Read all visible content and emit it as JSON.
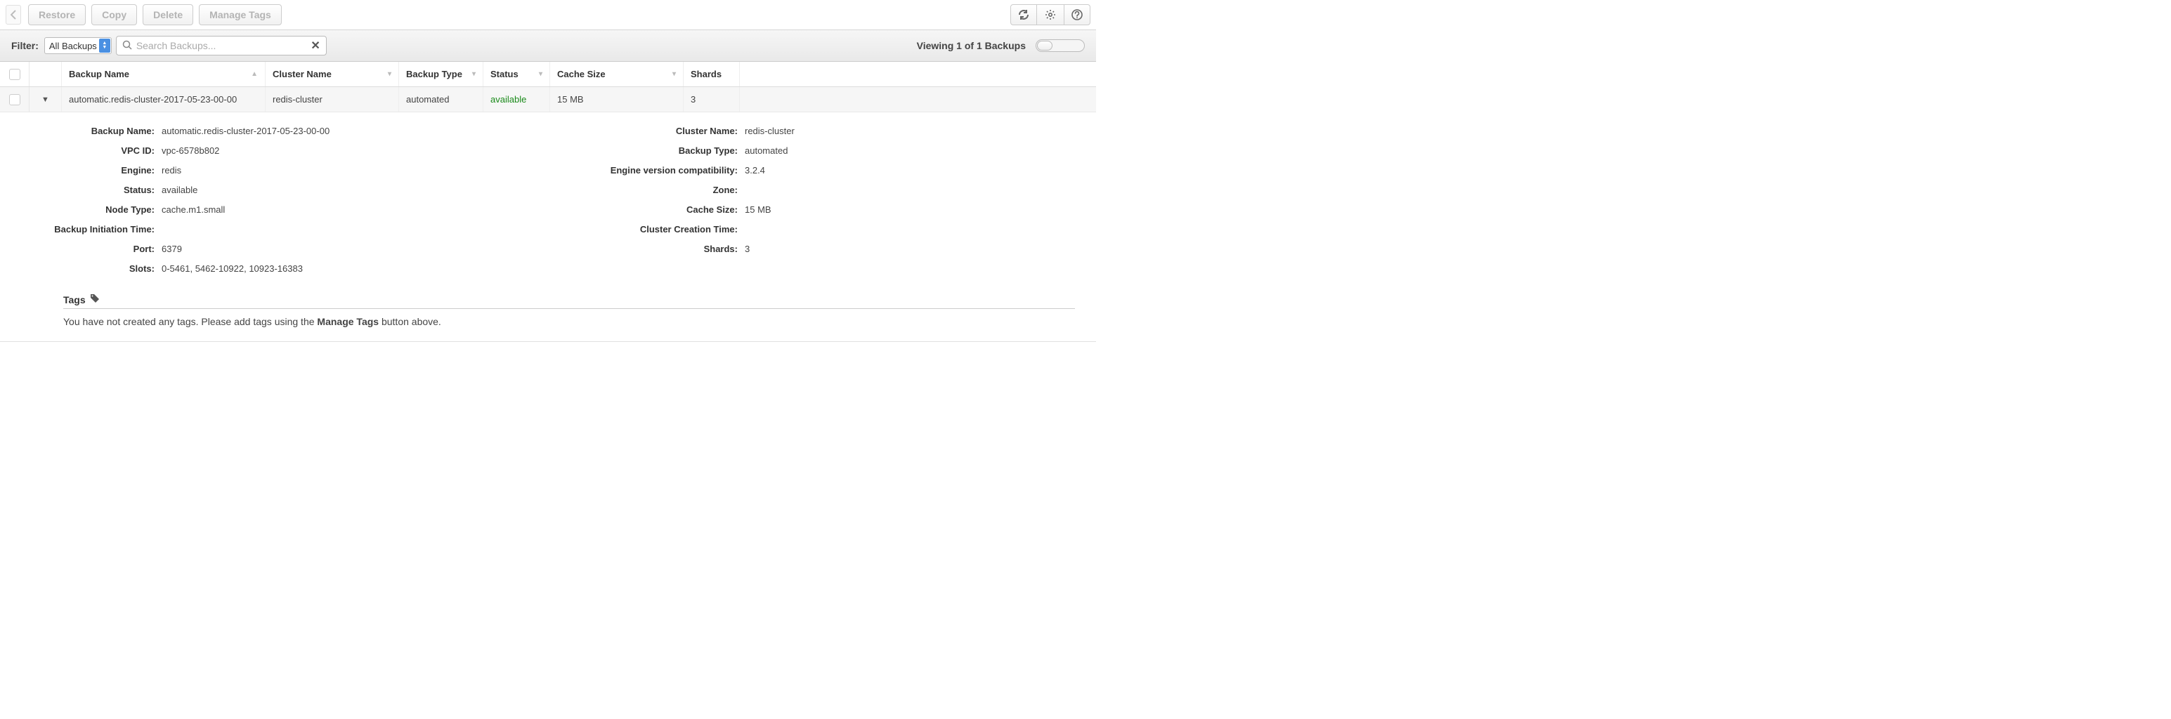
{
  "toolbar": {
    "restore": "Restore",
    "copy": "Copy",
    "delete": "Delete",
    "manage_tags": "Manage Tags"
  },
  "filter": {
    "label": "Filter:",
    "selected": "All Backups",
    "search_placeholder": "Search Backups...",
    "viewing": "Viewing 1 of 1 Backups"
  },
  "columns": {
    "name": "Backup Name",
    "cluster": "Cluster Name",
    "type": "Backup Type",
    "status": "Status",
    "size": "Cache Size",
    "shards": "Shards"
  },
  "rows": [
    {
      "name": "automatic.redis-cluster-2017-05-23-00-00",
      "cluster": "redis-cluster",
      "type": "automated",
      "status": "available",
      "size": "15 MB",
      "shards": "3"
    }
  ],
  "detail": {
    "left": {
      "backup_name_k": "Backup Name:",
      "backup_name_v": "automatic.redis-cluster-2017-05-23-00-00",
      "vpc_id_k": "VPC ID:",
      "vpc_id_v": "vpc-6578b802",
      "engine_k": "Engine:",
      "engine_v": "redis",
      "status_k": "Status:",
      "status_v": "available",
      "node_type_k": "Node Type:",
      "node_type_v": "cache.m1.small",
      "init_time_k": "Backup Initiation Time:",
      "init_time_v": "",
      "port_k": "Port:",
      "port_v": "6379",
      "slots_k": "Slots:",
      "slots_v": "0-5461, 5462-10922, 10923-16383"
    },
    "right": {
      "cluster_name_k": "Cluster Name:",
      "cluster_name_v": "redis-cluster",
      "backup_type_k": "Backup Type:",
      "backup_type_v": "automated",
      "engine_ver_k": "Engine version compatibility:",
      "engine_ver_v": "3.2.4",
      "zone_k": "Zone:",
      "zone_v": "",
      "cache_size_k": "Cache Size:",
      "cache_size_v": "15 MB",
      "cluster_ctime_k": "Cluster Creation Time:",
      "cluster_ctime_v": "",
      "shards_k": "Shards:",
      "shards_v": "3"
    },
    "tags_title": "Tags",
    "tags_empty_pre": "You have not created any tags. Please add tags using the ",
    "tags_empty_bold": "Manage Tags",
    "tags_empty_post": " button above."
  }
}
